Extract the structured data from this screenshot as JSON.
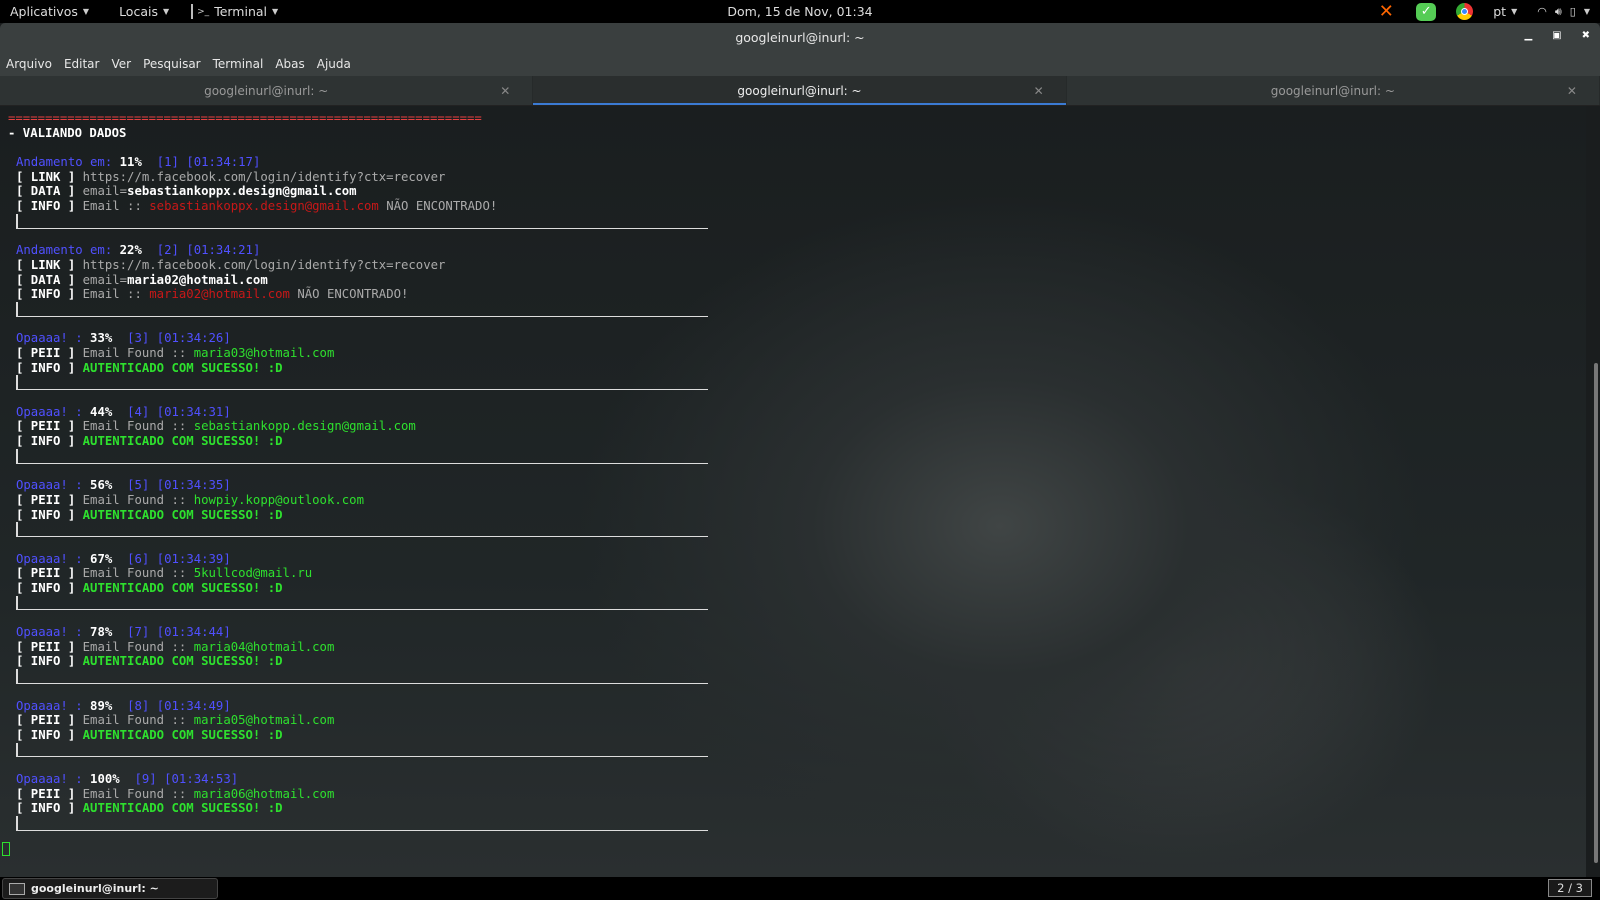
{
  "topbar": {
    "apps": "Aplicativos",
    "places": "Locais",
    "app_menu": "Terminal",
    "clock": "Dom, 15 de Nov, 01:34",
    "lang": "pt"
  },
  "window": {
    "title": "googleinurl@inurl: ~"
  },
  "menu": [
    "Arquivo",
    "Editar",
    "Ver",
    "Pesquisar",
    "Terminal",
    "Abas",
    "Ajuda"
  ],
  "tabs": [
    {
      "label": "googleinurl@inurl: ~",
      "active": false
    },
    {
      "label": "googleinurl@inurl: ~",
      "active": true
    },
    {
      "label": "googleinurl@inurl: ~",
      "active": false
    }
  ],
  "terminal": {
    "rule": "================================================================",
    "heading": "- VALIANDO DADOS",
    "blocks": [
      {
        "kind": "fail",
        "label": "Andamento em:",
        "pct": "11%",
        "n": "[1]",
        "time": "[01:34:17]",
        "link": "https://m.facebook.com/login/identify?ctx=recover",
        "email": "sebastiankoppx.design@gmail.com",
        "status": "NÃO ENCONTRADO!"
      },
      {
        "kind": "fail",
        "label": "Andamento em:",
        "pct": "22%",
        "n": "[2]",
        "time": "[01:34:21]",
        "link": "https://m.facebook.com/login/identify?ctx=recover",
        "email": "maria02@hotmail.com",
        "status": "NÃO ENCONTRADO!"
      },
      {
        "kind": "ok",
        "label": "Opaaaa! :",
        "pct": "33%",
        "n": "[3]",
        "time": "[01:34:26]",
        "email": "maria03@hotmail.com",
        "status": "AUTENTICADO COM SUCESSO! :D"
      },
      {
        "kind": "ok",
        "label": "Opaaaa! :",
        "pct": "44%",
        "n": "[4]",
        "time": "[01:34:31]",
        "email": "sebastiankopp.design@gmail.com",
        "status": "AUTENTICADO COM SUCESSO! :D"
      },
      {
        "kind": "ok",
        "label": "Opaaaa! :",
        "pct": "56%",
        "n": "[5]",
        "time": "[01:34:35]",
        "email": "howpiy.kopp@outlook.com",
        "status": "AUTENTICADO COM SUCESSO! :D"
      },
      {
        "kind": "ok",
        "label": "Opaaaa! :",
        "pct": "67%",
        "n": "[6]",
        "time": "[01:34:39]",
        "email": "5kullcod@mail.ru",
        "status": "AUTENTICADO COM SUCESSO! :D"
      },
      {
        "kind": "ok",
        "label": "Opaaaa! :",
        "pct": "78%",
        "n": "[7]",
        "time": "[01:34:44]",
        "email": "maria04@hotmail.com",
        "status": "AUTENTICADO COM SUCESSO! :D"
      },
      {
        "kind": "ok",
        "label": "Opaaaa! :",
        "pct": "89%",
        "n": "[8]",
        "time": "[01:34:49]",
        "email": "maria05@hotmail.com",
        "status": "AUTENTICADO COM SUCESSO! :D"
      },
      {
        "kind": "ok",
        "label": "Opaaaa! :",
        "pct": "100%",
        "n": "[9]",
        "time": "[01:34:53]",
        "email": "maria06@hotmail.com",
        "status": "AUTENTICADO COM SUCESSO! :D"
      }
    ],
    "tags": {
      "link": "[ LINK ]",
      "data": "[ DATA ]",
      "info": "[ INFO ]",
      "peii": "[ PEII ]"
    },
    "texts": {
      "email_eq": "email=",
      "email_sep": "Email :: ",
      "found": "Email Found :: "
    }
  },
  "taskbar": {
    "task": "googleinurl@inurl: ~",
    "workspace": "2 / 3"
  }
}
